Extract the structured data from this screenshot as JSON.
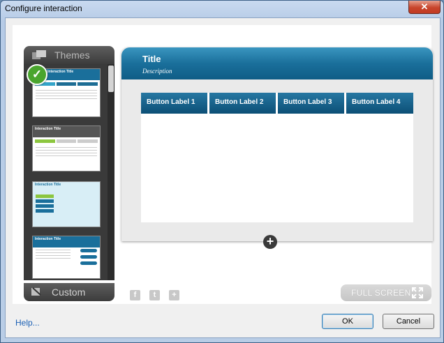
{
  "window": {
    "title": "Configure interaction",
    "close_label": "✕"
  },
  "sidebar": {
    "themes_label": "Themes",
    "custom_label": "Custom",
    "thumbnails": [
      {
        "title": "Interaction Title",
        "selected": true,
        "header_color": "#1a6f9b"
      },
      {
        "title": "Interaction Title",
        "selected": false,
        "header_color": "#555555"
      },
      {
        "title": "Interaction Title",
        "selected": false,
        "header_color": "#cde8f2"
      },
      {
        "title": "Interaction Title",
        "selected": false,
        "header_color": "#1a6f9b"
      }
    ]
  },
  "preview": {
    "title": "Title",
    "description": "Description",
    "buttons": [
      "Button Label 1",
      "Button Label 2",
      "Button Label 3",
      "Button Label 4"
    ]
  },
  "share_icons": [
    "facebook-icon",
    "twitter-icon",
    "google-plus-icon"
  ],
  "fullscreen_label": "FULL SCREEN",
  "footer": {
    "help_label": "Help...",
    "ok_label": "OK",
    "cancel_label": "Cancel"
  },
  "colors": {
    "accent": "#1a6f9b",
    "check": "#4aa52e"
  }
}
